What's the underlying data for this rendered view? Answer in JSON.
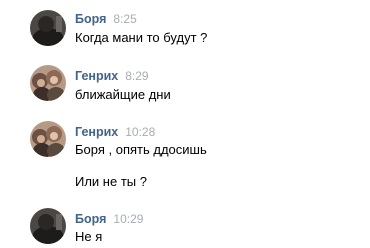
{
  "messages": [
    {
      "author": "Боря",
      "time": "8:25",
      "lines": [
        "Когда мани то будут ?"
      ],
      "avatar_icon": "user-avatar-dark"
    },
    {
      "author": "Генрих",
      "time": "8:29",
      "lines": [
        "ближайщие дни"
      ],
      "avatar_icon": "user-avatar-photo"
    },
    {
      "author": "Генрих",
      "time": "10:28",
      "lines": [
        "Боря , опять ддосишь",
        "Или не ты ?"
      ],
      "avatar_icon": "user-avatar-photo"
    },
    {
      "author": "Боря",
      "time": "10:29",
      "lines": [
        "Не я"
      ],
      "avatar_icon": "user-avatar-dark"
    }
  ],
  "colors": {
    "author_name": "#42648b",
    "timestamp": "#a8adb4",
    "text": "#000000",
    "background": "#ffffff"
  }
}
